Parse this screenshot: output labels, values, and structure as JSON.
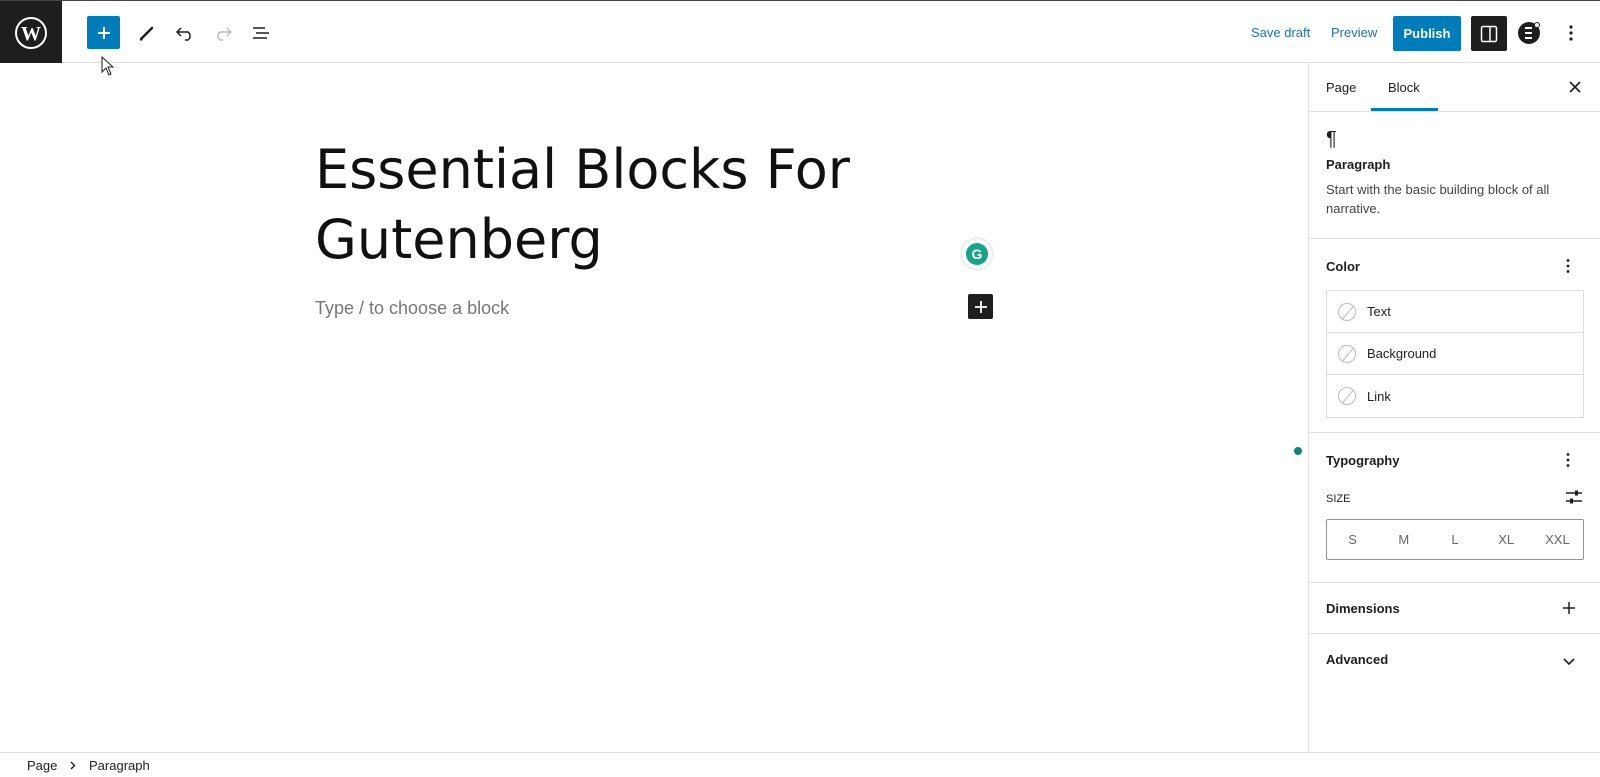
{
  "toolbar": {
    "save_draft": "Save draft",
    "preview": "Preview",
    "publish": "Publish"
  },
  "editor": {
    "title": "Essential Blocks For Gutenberg",
    "placeholder": "Type / to choose a block",
    "grammarly_letter": "G"
  },
  "sidebar": {
    "tabs": [
      "Page",
      "Block"
    ],
    "active_tab": "Block",
    "block": {
      "icon": "¶",
      "name": "Paragraph",
      "description": "Start with the basic building block of all narrative."
    },
    "color": {
      "title": "Color",
      "items": [
        "Text",
        "Background",
        "Link"
      ]
    },
    "typography": {
      "title": "Typography",
      "size_label": "SIZE",
      "sizes": [
        "S",
        "M",
        "L",
        "XL",
        "XXL"
      ]
    },
    "dimensions": {
      "title": "Dimensions"
    },
    "advanced": {
      "title": "Advanced"
    }
  },
  "breadcrumb": [
    "Page",
    "Paragraph"
  ],
  "colors": {
    "accent": "#007cba",
    "dark": "#1e1e1e",
    "grammarly": "#15a38a"
  }
}
